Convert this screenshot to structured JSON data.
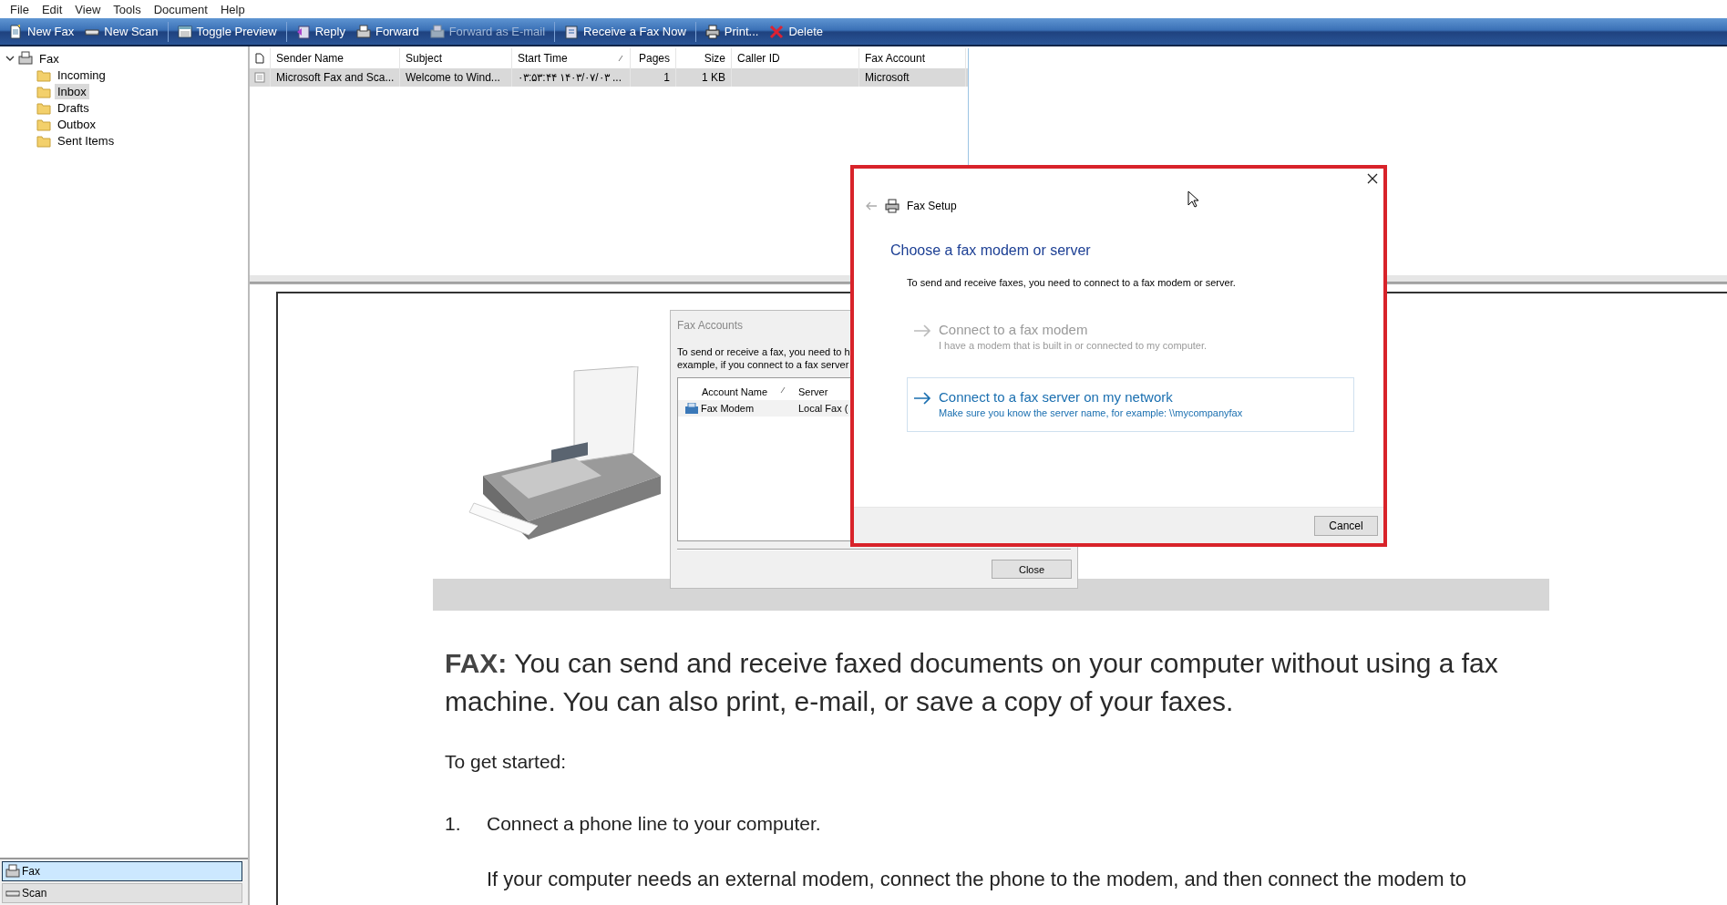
{
  "menu": [
    "File",
    "Edit",
    "View",
    "Tools",
    "Document",
    "Help"
  ],
  "toolbar": [
    {
      "items": [
        {
          "label": "New Fax",
          "disabled": false
        },
        {
          "label": "New Scan",
          "disabled": false
        }
      ]
    },
    {
      "items": [
        {
          "label": "Toggle Preview",
          "disabled": false
        }
      ]
    },
    {
      "items": [
        {
          "label": "Reply",
          "disabled": false
        },
        {
          "label": "Forward",
          "disabled": false
        },
        {
          "label": "Forward as E-mail",
          "disabled": true
        }
      ]
    },
    {
      "items": [
        {
          "label": "Receive a Fax Now",
          "disabled": false
        }
      ]
    },
    {
      "items": [
        {
          "label": "Print...",
          "disabled": false
        },
        {
          "label": "Delete",
          "disabled": false
        }
      ]
    }
  ],
  "folders": [
    {
      "label": "Fax",
      "expanded": true,
      "selected": false,
      "children": [
        {
          "label": "Incoming",
          "selected": false
        },
        {
          "label": "Inbox",
          "selected": true
        },
        {
          "label": "Drafts",
          "selected": false
        },
        {
          "label": "Outbox",
          "selected": false
        },
        {
          "label": "Sent Items",
          "selected": false
        }
      ]
    }
  ],
  "nav_buttons": [
    {
      "label": "Fax",
      "selected": true
    },
    {
      "label": "Scan",
      "selected": false
    }
  ],
  "table": {
    "columns": [
      "Sender Name",
      "Subject",
      "Start Time",
      "Pages",
      "Size",
      "Caller ID",
      "Fax Account"
    ],
    "rows": [
      {
        "selected": true,
        "cells": [
          "Microsoft Fax and Sca...",
          "Welcome to Wind...",
          "۰۳:۵۳:۴۴ ۱۴۰۳/۰۷/۰۳ ...",
          "1",
          "1 KB",
          "",
          "Microsoft"
        ]
      }
    ]
  },
  "preview": {
    "intro": "**FAX:** You can send and receive faxed documents on your computer without using a fax machine. You can also print, e-mail, or save a copy of your faxes.",
    "subheading": "To get started:",
    "steps": [
      {
        "number": "1.",
        "text": "Connect a phone line to your computer.",
        "detail": "If your computer needs an external modem, connect the phone to the modem, and then connect the modem to"
      }
    ]
  },
  "fax_accounts": {
    "title": "Fax Accounts",
    "description": [
      "To send or receive a fax, you need to h",
      "example, if you connect to a fax server"
    ],
    "columns": [
      "Account Name",
      "Server"
    ],
    "rows": [
      {
        "cells": [
          "Fax Modem",
          "Local Fax ("
        ]
      }
    ],
    "close_button": "Close"
  },
  "fax_setup": {
    "title": "Fax Setup",
    "heading": "Choose a fax modem or server",
    "intro": "To send and receive faxes, you need to connect to a fax modem or server.",
    "options": [
      {
        "title": "Connect to a fax modem",
        "description": "I have a modem that is built in or connected to my computer.",
        "disabled": true,
        "selected": false
      },
      {
        "title": "Connect to a fax server on my network",
        "description": "Make sure you know the server name, for example: \\\\mycompanyfax",
        "disabled": false,
        "selected": true
      }
    ],
    "cancel_button": "Cancel"
  }
}
